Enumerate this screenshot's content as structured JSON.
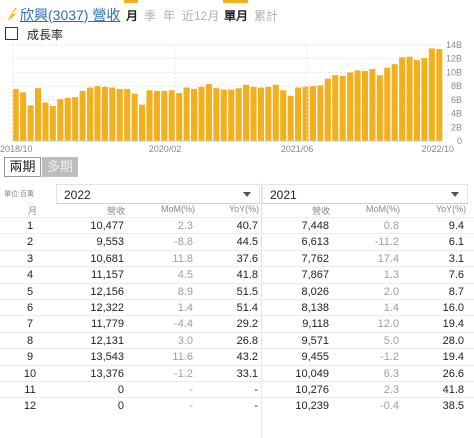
{
  "header": {
    "title": "欣興(3037) 營收",
    "logo_icon": "lightning-bolt-icon",
    "tabs": [
      {
        "label": "月",
        "active": true
      },
      {
        "label": "季",
        "active": false
      },
      {
        "label": "年",
        "active": false
      },
      {
        "label": "近12月",
        "active": false
      },
      {
        "label": "單月",
        "active": true
      },
      {
        "label": "累計",
        "active": false
      }
    ],
    "accent_color": "#f2b01e"
  },
  "growth_checkbox": {
    "label": "成長率",
    "checked": false
  },
  "chart_data": {
    "type": "bar",
    "color": "#f2b01e",
    "x_tick_labels": [
      "2018/10",
      "2020/02",
      "2021/06",
      "2022/10"
    ],
    "y_tick_labels": [
      "0",
      "2B",
      "4B",
      "6B",
      "8B",
      "10B",
      "12B",
      "14B"
    ],
    "ylim": [
      0,
      14
    ],
    "grid": true,
    "values": [
      7.6,
      7.1,
      5.2,
      7.7,
      5.6,
      5.1,
      6.1,
      6.3,
      6.4,
      7.3,
      7.8,
      8.0,
      7.9,
      7.8,
      7.6,
      7.6,
      6.9,
      5.3,
      7.4,
      7.3,
      7.3,
      7.4,
      7.0,
      7.8,
      7.6,
      7.9,
      8.3,
      7.7,
      7.5,
      7.5,
      7.7,
      8.2,
      7.9,
      7.8,
      7.9,
      8.2,
      7.4,
      6.6,
      7.8,
      7.9,
      8.0,
      8.1,
      9.1,
      9.6,
      9.5,
      10.0,
      10.3,
      10.2,
      10.5,
      9.6,
      10.7,
      11.2,
      12.2,
      12.3,
      11.8,
      12.1,
      13.5,
      13.4
    ],
    "axis_unit": "B"
  },
  "period_toggle": {
    "selected": "兩期",
    "other": "多期"
  },
  "table": {
    "unit_label": "單位:百萬",
    "month_header": "月",
    "columns": {
      "revenue": "營收",
      "mom": "MoM(%)",
      "yoy": "YoY(%)"
    },
    "years": [
      "2022",
      "2021"
    ],
    "rows": [
      {
        "month": "1",
        "a_rev": "10,477",
        "a_mom": "2.3",
        "a_yoy": "40.7",
        "b_rev": "7,448",
        "b_mom": "0.8",
        "b_yoy": "9.4"
      },
      {
        "month": "2",
        "a_rev": "9,553",
        "a_mom": "-8.8",
        "a_yoy": "44.5",
        "b_rev": "6,613",
        "b_mom": "-11.2",
        "b_yoy": "6.1"
      },
      {
        "month": "3",
        "a_rev": "10,681",
        "a_mom": "11.8",
        "a_yoy": "37.6",
        "b_rev": "7,762",
        "b_mom": "17.4",
        "b_yoy": "3.1"
      },
      {
        "month": "4",
        "a_rev": "11,157",
        "a_mom": "4.5",
        "a_yoy": "41.8",
        "b_rev": "7,867",
        "b_mom": "1.3",
        "b_yoy": "7.6"
      },
      {
        "month": "5",
        "a_rev": "12,156",
        "a_mom": "8.9",
        "a_yoy": "51.5",
        "b_rev": "8,026",
        "b_mom": "2.0",
        "b_yoy": "8.7"
      },
      {
        "month": "6",
        "a_rev": "12,322",
        "a_mom": "1.4",
        "a_yoy": "51.4",
        "b_rev": "8,138",
        "b_mom": "1.4",
        "b_yoy": "16.0"
      },
      {
        "month": "7",
        "a_rev": "11,779",
        "a_mom": "-4.4",
        "a_yoy": "29.2",
        "b_rev": "9,118",
        "b_mom": "12.0",
        "b_yoy": "19.4"
      },
      {
        "month": "8",
        "a_rev": "12,131",
        "a_mom": "3.0",
        "a_yoy": "26.8",
        "b_rev": "9,571",
        "b_mom": "5.0",
        "b_yoy": "28.0"
      },
      {
        "month": "9",
        "a_rev": "13,543",
        "a_mom": "11.6",
        "a_yoy": "43.2",
        "b_rev": "9,455",
        "b_mom": "-1.2",
        "b_yoy": "19.4"
      },
      {
        "month": "10",
        "a_rev": "13,376",
        "a_mom": "-1.2",
        "a_yoy": "33.1",
        "b_rev": "10,049",
        "b_mom": "6.3",
        "b_yoy": "26.6"
      },
      {
        "month": "11",
        "a_rev": "0",
        "a_mom": "-",
        "a_yoy": "-",
        "b_rev": "10,276",
        "b_mom": "2.3",
        "b_yoy": "41.8"
      },
      {
        "month": "12",
        "a_rev": "0",
        "a_mom": "-",
        "a_yoy": "-",
        "b_rev": "10,239",
        "b_mom": "-0.4",
        "b_yoy": "38.5"
      }
    ]
  }
}
